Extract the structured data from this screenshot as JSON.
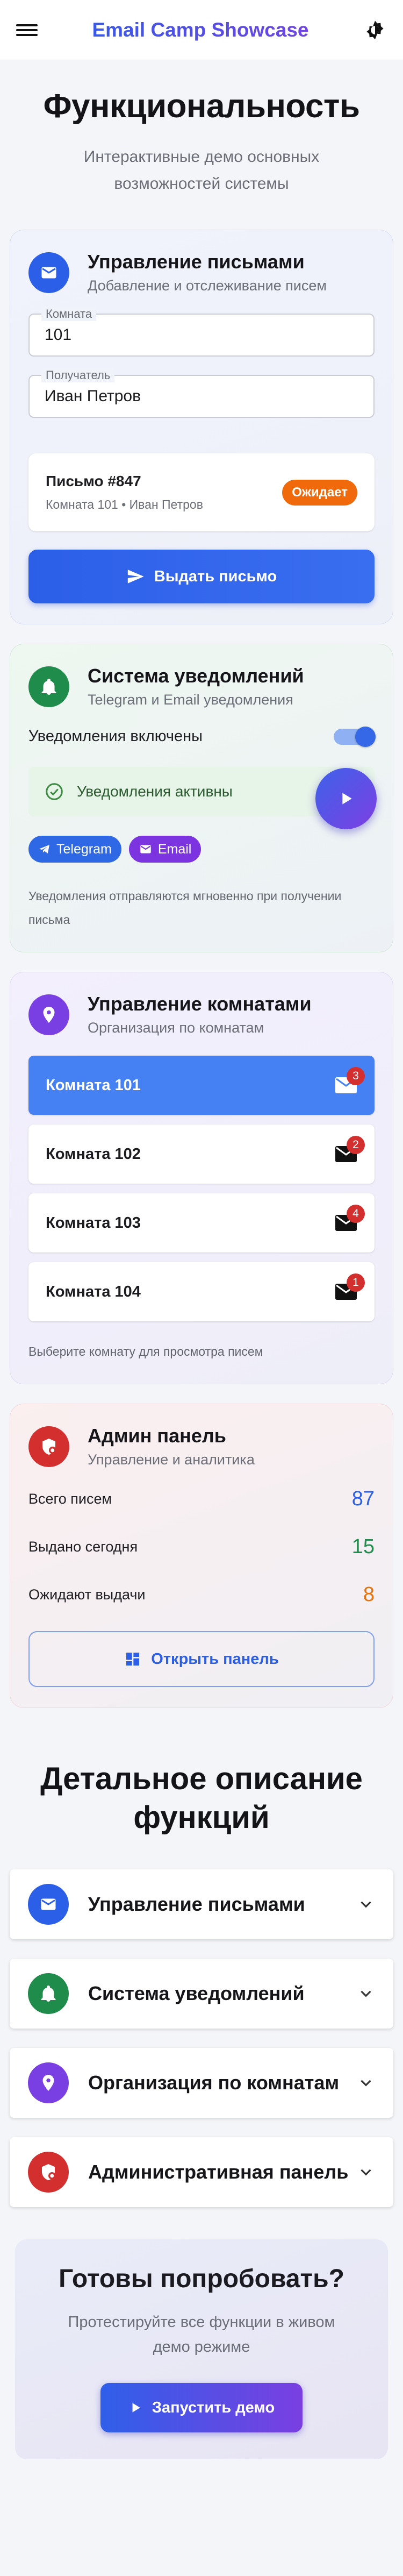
{
  "appbar": {
    "title": "Email Camp Showcase",
    "menu_icon": "menu-icon",
    "theme_icon": "theme-toggle-icon"
  },
  "hero": {
    "title": "Функциональность",
    "subtitle": "Интерактивные демо основных возможностей системы"
  },
  "mail": {
    "title": "Управление письмами",
    "subtitle": "Добавление и отслеживание писем",
    "room_field": {
      "label": "Комната",
      "value": "101"
    },
    "recipient_field": {
      "label": "Получатель",
      "value": "Иван Петров"
    },
    "letter": {
      "title": "Письмо #847",
      "meta": "Комната 101 • Иван Петров",
      "status": "Ожидает"
    },
    "issue_button": "Выдать письмо",
    "accent": "#2c5fe8"
  },
  "notifications": {
    "title": "Система уведомлений",
    "subtitle": "Telegram и Email уведомления",
    "toggle_label": "Уведомления включены",
    "toggle_on": true,
    "status_text": "Уведомления активны",
    "chips": [
      "Telegram",
      "Email"
    ],
    "note": "Уведомления отправляются мгновенно при получении письма",
    "accent": "#1f8c4c"
  },
  "rooms": {
    "title": "Управление комнатами",
    "subtitle": "Организация по комнатам",
    "items": [
      {
        "label": "Комната 101",
        "count": "3",
        "active": true
      },
      {
        "label": "Комната 102",
        "count": "2",
        "active": false
      },
      {
        "label": "Комната 103",
        "count": "4",
        "active": false
      },
      {
        "label": "Комната 104",
        "count": "1",
        "active": false
      }
    ],
    "hint": "Выберите комнату для просмотра писем",
    "accent": "#7a3fe2"
  },
  "admin": {
    "title": "Админ панель",
    "subtitle": "Управление и аналитика",
    "stats": [
      {
        "label": "Всего писем",
        "value": "87",
        "color": "#2c5fe8"
      },
      {
        "label": "Выдано сегодня",
        "value": "15",
        "color": "#1f8c4c"
      },
      {
        "label": "Ожидают выдачи",
        "value": "8",
        "color": "#e8720c"
      }
    ],
    "open_button": "Открыть панель",
    "accent": "#d32f2f"
  },
  "details": {
    "title": "Детальное описание функций",
    "items": [
      {
        "label": "Управление письмами",
        "icon": "mail-icon"
      },
      {
        "label": "Система уведомлений",
        "icon": "bell-icon"
      },
      {
        "label": "Организация по комнатам",
        "icon": "location-icon"
      },
      {
        "label": "Административная панель",
        "icon": "admin-shield-icon"
      }
    ]
  },
  "cta": {
    "title": "Готовы попробовать?",
    "text": "Протестируйте все функции в живом демо режиме",
    "button": "Запустить демо"
  }
}
